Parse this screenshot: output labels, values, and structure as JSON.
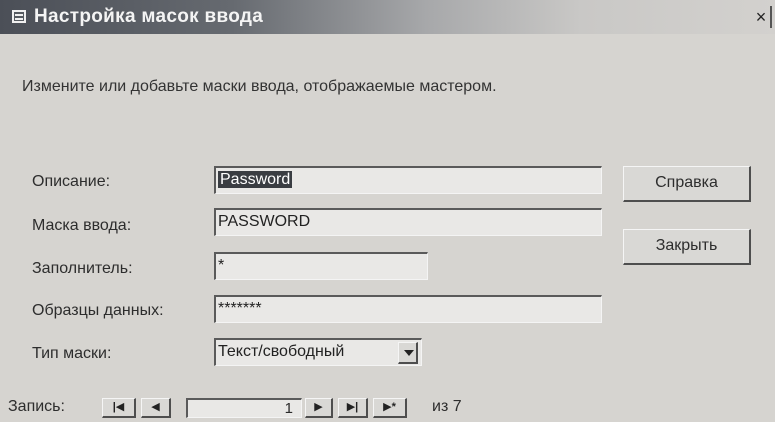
{
  "window": {
    "title": "Настройка масок ввода",
    "close_label": "×"
  },
  "instruction": "Измените или добавьте маски ввода, отображаемые мастером.",
  "fields": {
    "description": {
      "label": "Описание:",
      "value": "Password"
    },
    "input_mask": {
      "label": "Маска ввода:",
      "value": "PASSWORD"
    },
    "placeholder": {
      "label": "Заполнитель:",
      "value": "*"
    },
    "sample_data": {
      "label": "Образцы данных:",
      "value": "*******"
    },
    "mask_type": {
      "label": "Тип маски:",
      "value": "Текст/свободный"
    }
  },
  "buttons": {
    "help": "Справка",
    "close": "Закрыть"
  },
  "navigator": {
    "label": "Запись:",
    "first": "|◀",
    "prev": "◀",
    "current": "1",
    "next": "▶",
    "last": "▶|",
    "new": "▶*",
    "total_text": "из 7"
  }
}
